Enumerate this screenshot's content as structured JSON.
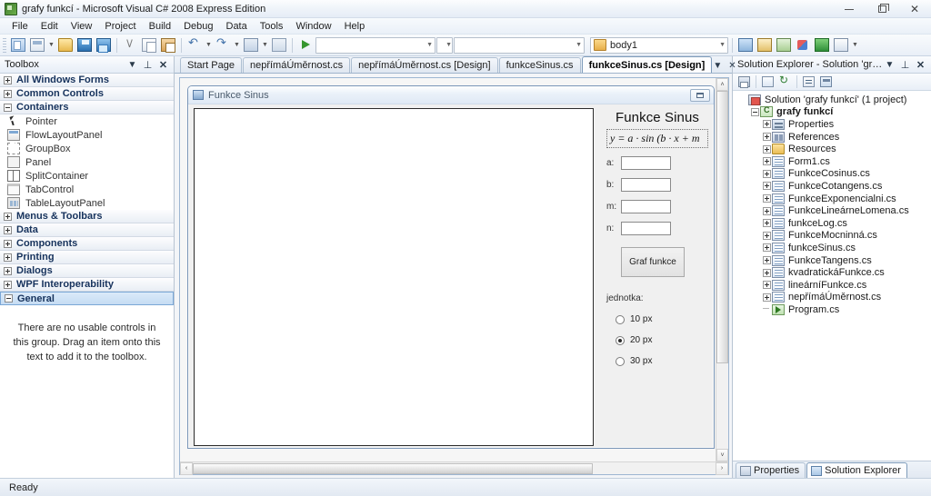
{
  "window": {
    "title": "grafy funkcí - Microsoft Visual C# 2008 Express Edition",
    "app_icon": "visual-studio-icon",
    "minimize": "–",
    "restore": "❐",
    "close": "✕"
  },
  "menu": {
    "items": [
      {
        "label": "File",
        "mnemonic": "F"
      },
      {
        "label": "Edit",
        "mnemonic": "E"
      },
      {
        "label": "View",
        "mnemonic": "V"
      },
      {
        "label": "Project",
        "mnemonic": "P"
      },
      {
        "label": "Build",
        "mnemonic": "B"
      },
      {
        "label": "Debug",
        "mnemonic": "D"
      },
      {
        "label": "Data",
        "mnemonic": "a"
      },
      {
        "label": "Tools",
        "mnemonic": "T"
      },
      {
        "label": "Window",
        "mnemonic": "W"
      },
      {
        "label": "Help",
        "mnemonic": "H"
      }
    ]
  },
  "toolbar": {
    "buttons": [
      {
        "name": "new-project-icon",
        "cls": "newproj"
      },
      {
        "name": "add-new-item-icon",
        "cls": "addnew"
      },
      {
        "name": "open-file-icon",
        "cls": "open"
      },
      {
        "name": "save-icon",
        "cls": "save"
      },
      {
        "name": "save-all-icon",
        "cls": "saveall"
      },
      {
        "name": "cut-icon",
        "cls": "cut"
      },
      {
        "name": "copy-icon",
        "cls": "copy"
      },
      {
        "name": "paste-icon",
        "cls": "paste"
      },
      {
        "name": "undo-icon",
        "cls": "undo"
      },
      {
        "name": "redo-icon",
        "cls": "redo"
      },
      {
        "name": "navigate-backward-icon",
        "cls": "nav"
      },
      {
        "name": "navigate-forward-icon",
        "cls": "nav2"
      },
      {
        "name": "start-debugging-icon",
        "cls": "start"
      }
    ],
    "combo_empty_value": "",
    "target_combo_value": "body1",
    "right_buttons": [
      {
        "name": "solution-explorer-icon",
        "cls": "w1"
      },
      {
        "name": "properties-window-icon",
        "cls": "w2"
      },
      {
        "name": "object-browser-icon",
        "cls": "w3"
      },
      {
        "name": "toolbox-icon",
        "cls": "w4"
      },
      {
        "name": "start-page-icon",
        "cls": "w5"
      },
      {
        "name": "other-windows-icon",
        "cls": "w6"
      }
    ]
  },
  "toolbox": {
    "title": "Toolbox",
    "header_buttons": {
      "dropdown": "▼",
      "pin": "⊥",
      "close": "✕"
    },
    "categories": [
      {
        "label": "All Windows Forms",
        "expanded": false,
        "selected": false
      },
      {
        "label": "Common Controls",
        "expanded": false,
        "selected": false
      },
      {
        "label": "Containers",
        "expanded": true,
        "selected": false
      }
    ],
    "container_items": [
      {
        "label": "Pointer",
        "icon": "ti-pointer"
      },
      {
        "label": "FlowLayoutPanel",
        "icon": "ti-flow"
      },
      {
        "label": "GroupBox",
        "icon": "ti-group"
      },
      {
        "label": "Panel",
        "icon": "ti-panel"
      },
      {
        "label": "SplitContainer",
        "icon": "ti-split"
      },
      {
        "label": "TabControl",
        "icon": "ti-tab"
      },
      {
        "label": "TableLayoutPanel",
        "icon": "ti-table"
      }
    ],
    "categories_after": [
      {
        "label": "Menus & Toolbars",
        "expanded": false,
        "selected": false
      },
      {
        "label": "Data",
        "expanded": false,
        "selected": false
      },
      {
        "label": "Components",
        "expanded": false,
        "selected": false
      },
      {
        "label": "Printing",
        "expanded": false,
        "selected": false
      },
      {
        "label": "Dialogs",
        "expanded": false,
        "selected": false
      },
      {
        "label": "WPF Interoperability",
        "expanded": false,
        "selected": false
      },
      {
        "label": "General",
        "expanded": true,
        "selected": true
      }
    ],
    "empty_message": "There are no usable controls in this group. Drag an item onto this text to add it to the toolbox."
  },
  "document_tabs": {
    "tabs": [
      {
        "label": "Start Page",
        "active": false
      },
      {
        "label": "nepřímáÚměrnost.cs",
        "active": false
      },
      {
        "label": "nepřímáÚměrnost.cs [Design]",
        "active": false
      },
      {
        "label": "funkceSinus.cs",
        "active": false
      },
      {
        "label": "funkceSinus.cs [Design]",
        "active": true
      }
    ],
    "dropdown": "▼",
    "close": "✕"
  },
  "form_designer": {
    "form_title": "Funkce Sinus",
    "form_icon": "winform-icon",
    "restore_button": "restore-box",
    "heading": "Funkce Sinus",
    "formula": "y = a · sin (b · x + m",
    "fields": [
      {
        "label": "a:",
        "value": ""
      },
      {
        "label": "b:",
        "value": ""
      },
      {
        "label": "m:",
        "value": ""
      },
      {
        "label": "n:",
        "value": ""
      }
    ],
    "graph_button": "Graf funkce",
    "unit_label": "jednotka:",
    "radios": [
      {
        "label": "10 px",
        "checked": false
      },
      {
        "label": "20 px",
        "checked": true
      },
      {
        "label": "30 px",
        "checked": false
      }
    ],
    "scroll_up": "˄",
    "scroll_down": "˅",
    "scroll_left": "‹",
    "scroll_right": "›"
  },
  "solution_explorer": {
    "title": "Solution Explorer - Solution 'grafy funkc...",
    "header_buttons": {
      "dropdown": "▼",
      "pin": "⊥",
      "close": "✕"
    },
    "toolbar_buttons": [
      {
        "name": "properties-icon",
        "cls": "props"
      },
      {
        "name": "show-all-files-icon",
        "cls": "showall"
      },
      {
        "name": "refresh-icon",
        "cls": "refresh"
      },
      {
        "name": "view-code-icon",
        "cls": "viewcode"
      },
      {
        "name": "view-designer-icon",
        "cls": "viewdes"
      }
    ],
    "tree": [
      {
        "label": "Solution 'grafy funkcí' (1 project)",
        "indent": 0,
        "icon": "ic-sln",
        "expander": "none",
        "bold": false
      },
      {
        "label": "grafy funkcí",
        "indent": 1,
        "icon": "ic-proj",
        "expander": "minus",
        "bold": true
      },
      {
        "label": "Properties",
        "indent": 2,
        "icon": "ic-props",
        "expander": "plus",
        "bold": false
      },
      {
        "label": "References",
        "indent": 2,
        "icon": "ic-refs",
        "expander": "plus",
        "bold": false
      },
      {
        "label": "Resources",
        "indent": 2,
        "icon": "ic-folder",
        "expander": "plus",
        "bold": false
      },
      {
        "label": "Form1.cs",
        "indent": 2,
        "icon": "ic-cs",
        "expander": "plus",
        "bold": false
      },
      {
        "label": "FunkceCosinus.cs",
        "indent": 2,
        "icon": "ic-cs",
        "expander": "plus",
        "bold": false
      },
      {
        "label": "FunkceCotangens.cs",
        "indent": 2,
        "icon": "ic-cs",
        "expander": "plus",
        "bold": false
      },
      {
        "label": "FunkceExponencialni.cs",
        "indent": 2,
        "icon": "ic-cs",
        "expander": "plus",
        "bold": false
      },
      {
        "label": "FunkceLineárneLomena.cs",
        "indent": 2,
        "icon": "ic-cs",
        "expander": "plus",
        "bold": false
      },
      {
        "label": "funkceLog.cs",
        "indent": 2,
        "icon": "ic-cs",
        "expander": "plus",
        "bold": false
      },
      {
        "label": "FunkceMocninná.cs",
        "indent": 2,
        "icon": "ic-cs",
        "expander": "plus",
        "bold": false
      },
      {
        "label": "funkceSinus.cs",
        "indent": 2,
        "icon": "ic-cs",
        "expander": "plus",
        "bold": false
      },
      {
        "label": "FunkceTangens.cs",
        "indent": 2,
        "icon": "ic-cs",
        "expander": "plus",
        "bold": false
      },
      {
        "label": "kvadratickáFunkce.cs",
        "indent": 2,
        "icon": "ic-cs",
        "expander": "plus",
        "bold": false
      },
      {
        "label": "lineárníFunkce.cs",
        "indent": 2,
        "icon": "ic-cs",
        "expander": "plus",
        "bold": false
      },
      {
        "label": "nepřímáÚměrnost.cs",
        "indent": 2,
        "icon": "ic-cs",
        "expander": "plus",
        "bold": false
      },
      {
        "label": "Program.cs",
        "indent": 2,
        "icon": "ic-prog",
        "expander": "leaf",
        "bold": false
      }
    ],
    "bottom_tabs": [
      {
        "label": "Properties",
        "active": false,
        "icon": "p"
      },
      {
        "label": "Solution Explorer",
        "active": true,
        "icon": "s"
      }
    ]
  },
  "statusbar": {
    "message": "Ready"
  }
}
